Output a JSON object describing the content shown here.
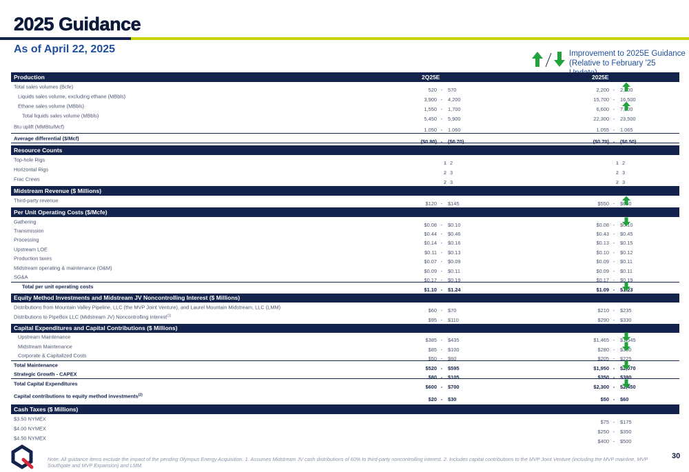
{
  "title": "2025 Guidance",
  "subtitle": "As of April 22, 2025",
  "legend": {
    "line1": "Improvement to 2025E Guidance",
    "line2": "(Relative to February '25 Update)",
    "up_color": "#1fa33a",
    "down_color": "#1fa33a"
  },
  "columns": {
    "q": "2Q25E",
    "y": "2025E"
  },
  "rows": [
    {
      "type": "hdr",
      "label": "Production",
      "showcols": true,
      "h": 14
    },
    {
      "label": "Total sales volumes (Bcfe)",
      "q": [
        "520",
        "570"
      ],
      "y": [
        "2,200",
        "2,300"
      ],
      "arrow": "up",
      "h": 14
    },
    {
      "label": "Liquids sales volume, excluding ethane (MBbls)",
      "ind": 1,
      "q": [
        "3,900",
        "4,200"
      ],
      "y": [
        "15,700",
        "16,500"
      ],
      "h": 14
    },
    {
      "label": "Ethane sales volume (MBbls)",
      "ind": 1,
      "q": [
        "1,550",
        "1,700"
      ],
      "y": [
        "6,600",
        "7,000"
      ],
      "arrow": "up",
      "h": 14
    },
    {
      "label": "Total liquids sales volume (MBbls)",
      "ind": 2,
      "q": [
        "5,450",
        "5,900"
      ],
      "y": [
        "22,300",
        "23,500"
      ],
      "h": 14
    },
    {
      "label": "Btu uplift (MMBtu/Mcf)",
      "q": [
        "1.050",
        "1.060"
      ],
      "y": [
        "1.055",
        "1.065"
      ],
      "h": 18
    },
    {
      "label": "Average differential ($/Mcf)",
      "bold": true,
      "top": true,
      "bottom": true,
      "q": [
        "($0.80)",
        "($0.70)"
      ],
      "y": [
        "($0.70)",
        "($0.50)"
      ],
      "h": 15
    },
    {
      "type": "hdr",
      "label": "Resource Counts",
      "h": 14,
      "gap": 3
    },
    {
      "label": "Top-hole Rigs",
      "q": [
        "1",
        "2"
      ],
      "y": [
        "1",
        "2"
      ],
      "h": 14,
      "small": true
    },
    {
      "label": "Horizontal Rigs",
      "q": [
        "2",
        "3"
      ],
      "y": [
        "2",
        "3"
      ],
      "h": 14,
      "small": true
    },
    {
      "label": "Frac Crews",
      "q": [
        "2",
        "3"
      ],
      "y": [
        "2",
        "3"
      ],
      "h": 14,
      "small": true
    },
    {
      "type": "hdr",
      "label": "Midstream Revenue ($ Millions)",
      "h": 14,
      "gap": 3
    },
    {
      "label": "Third-party revenue",
      "q": [
        "$120",
        "$145"
      ],
      "y": [
        "$550",
        "$650"
      ],
      "arrow": "up",
      "h": 14
    },
    {
      "type": "hdr",
      "label": "Per Unit Operating Costs ($/Mcfe)",
      "h": 14,
      "gap": 3
    },
    {
      "label": "Gathering",
      "q": [
        "$0.08",
        "$0.10"
      ],
      "y": [
        "$0.08",
        "$0.10"
      ],
      "arrow": "down",
      "h": 13.4
    },
    {
      "label": "Transmission",
      "q": [
        "$0.44",
        "$0.46"
      ],
      "y": [
        "$0.43",
        "$0.45"
      ],
      "h": 13.4
    },
    {
      "label": "Processing",
      "q": [
        "$0.14",
        "$0.16"
      ],
      "y": [
        "$0.13",
        "$0.15"
      ],
      "h": 13.4
    },
    {
      "label": "Upstream LOE",
      "q": [
        "$0.11",
        "$0.13"
      ],
      "y": [
        "$0.10",
        "$0.12"
      ],
      "h": 13.4
    },
    {
      "label": "Production taxes",
      "q": [
        "$0.07",
        "$0.09"
      ],
      "y": [
        "$0.09",
        "$0.11"
      ],
      "h": 13.4
    },
    {
      "label": "Midstream operating & maintenance (O&M)",
      "q": [
        "$0.09",
        "$0.11"
      ],
      "y": [
        "$0.09",
        "$0.11"
      ],
      "h": 13.4
    },
    {
      "label": "SG&A",
      "q": [
        "$0.17",
        "$0.19"
      ],
      "y": [
        "$0.17",
        "$0.19"
      ],
      "h": 13.4
    },
    {
      "label": "Total per unit operating costs",
      "ind": 2,
      "bold": true,
      "top": true,
      "q": [
        "$1.10",
        "$1.24"
      ],
      "y": [
        "$1.09",
        "$1.23"
      ],
      "arrow": "down",
      "h": 14
    },
    {
      "type": "hdr",
      "label": "Equity Method Investments and Midstream JV Noncontrolling Interest ($ Millions)",
      "h": 13,
      "gap": 3
    },
    {
      "label": "Distributions from Mountain Valley Pipeline, LLC (the MVP Joint Venture), and Laurel Mountain Midstream, LLC (LMM)",
      "q": [
        "$60",
        "$70"
      ],
      "y": [
        "$210",
        "$235"
      ],
      "h": 14
    },
    {
      "label": "Distributions to PipeBox LLC (Midstream JV) Noncontrolling Interest",
      "sup": "(1)",
      "q": [
        "$95",
        "$110"
      ],
      "y": [
        "$290",
        "$330"
      ],
      "h": 15
    },
    {
      "type": "hdr",
      "label": "Capital Expenditures and Capital Contributions ($ Millions)",
      "h": 13,
      "gap": 2
    },
    {
      "label": "Upstream Maintenance",
      "ind": 1,
      "q": [
        "$385",
        "$435"
      ],
      "y": [
        "$1,465",
        "$1,545"
      ],
      "arrow": "down",
      "h": 13.5
    },
    {
      "label": "Midstream Maintenance",
      "ind": 1,
      "q": [
        "$85",
        "$100"
      ],
      "y": [
        "$280",
        "$300"
      ],
      "arrow": "down",
      "h": 13.5
    },
    {
      "label": "Corporate & Capitalized Costs",
      "ind": 1,
      "q": [
        "$50",
        "$60"
      ],
      "y": [
        "$205",
        "$225"
      ],
      "h": 13.5
    },
    {
      "label": "Total Maintenance",
      "bold": true,
      "top": true,
      "q": [
        "$520",
        "$595"
      ],
      "y": [
        "$1,950",
        "$2,070"
      ],
      "arrow": "down",
      "h": 13.5
    },
    {
      "label": "Strategic Growth - CAPEX",
      "bold": true,
      "bottom": true,
      "q": [
        "$80",
        "$105"
      ],
      "y": [
        "$350",
        "$380"
      ],
      "h": 13.5
    },
    {
      "label": "Total Capital Expenditures",
      "bold": true,
      "q": [
        "$600",
        "$700"
      ],
      "y": [
        "$2,300",
        "$2,450"
      ],
      "arrow": "down",
      "h": 14
    },
    {
      "label": "Capital contributions to equity method investments",
      "sup": "(2)",
      "bold": true,
      "q": [
        "$20",
        "$30"
      ],
      "y": [
        "$50",
        "$60"
      ],
      "h": 21
    },
    {
      "type": "hdr",
      "label": "Cash Taxes ($ Millions)",
      "h": 14,
      "gap": 2
    },
    {
      "label": "$3.50 NYMEX",
      "y": [
        "$75",
        "$175"
      ],
      "h": 14
    },
    {
      "label": "$4.00 NYMEX",
      "y": [
        "$250",
        "$350"
      ],
      "h": 14
    },
    {
      "label": "$4.50 NYMEX",
      "y": [
        "$400",
        "$500"
      ],
      "h": 14
    }
  ],
  "footnote": "Note: All guidance items exclude the impact of the pending Olympus Energy Acquisition. 1. Assumes Midstream JV cash distributions of 60% to third-party noncontrolling interest. 2. Includes capital contributions to the MVP Joint Venture (including the MVP mainline, MVP Southgate and MVP Expansion) and LMM.",
  "page_number": "30",
  "colors": {
    "navy": "#14234b",
    "lime": "#c8d400",
    "blue": "#1f4e9c",
    "arrow": "#1fa33a",
    "logo_red": "#d6293e"
  }
}
